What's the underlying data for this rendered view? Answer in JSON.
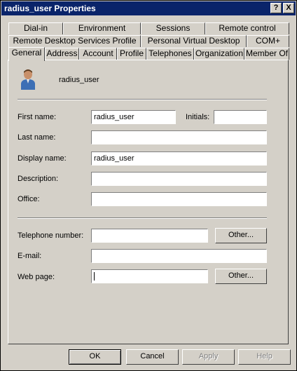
{
  "window": {
    "title": "radius_user Properties",
    "help_label": "?",
    "close_label": "X"
  },
  "tabs": {
    "row1": [
      "Dial-in",
      "Environment",
      "Sessions",
      "Remote control"
    ],
    "row2": [
      "Remote Desktop Services Profile",
      "Personal Virtual Desktop",
      "COM+"
    ],
    "row3": [
      "General",
      "Address",
      "Account",
      "Profile",
      "Telephones",
      "Organization",
      "Member Of"
    ],
    "active": "General"
  },
  "general": {
    "user_icon": "user-icon",
    "username": "radius_user",
    "first_name_label": "First name:",
    "first_name_value": "radius_user",
    "initials_label": "Initials:",
    "initials_value": "",
    "last_name_label": "Last name:",
    "last_name_value": "",
    "display_name_label": "Display name:",
    "display_name_value": "radius_user",
    "description_label": "Description:",
    "description_value": "",
    "office_label": "Office:",
    "office_value": "",
    "telephone_label": "Telephone number:",
    "telephone_value": "",
    "telephone_other_label": "Other...",
    "email_label": "E-mail:",
    "email_value": "",
    "webpage_label": "Web page:",
    "webpage_value": "",
    "webpage_other_label": "Other..."
  },
  "footer": {
    "ok_label": "OK",
    "cancel_label": "Cancel",
    "apply_label": "Apply",
    "help_label": "Help"
  }
}
